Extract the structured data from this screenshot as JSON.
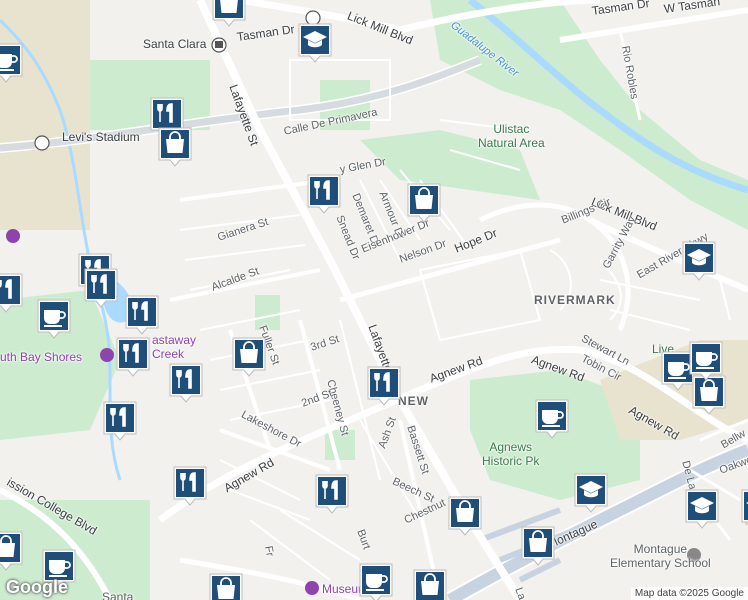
{
  "map": {
    "attribution": "Map data ©2025 Google",
    "google_logo": "Google",
    "street_labels": [
      {
        "id": "lick-mill-blvd-top",
        "text": "Lick Mill Blvd"
      },
      {
        "id": "tasman-dr",
        "text": "Tasman Dr"
      },
      {
        "id": "w-tasman",
        "text": "W Tasman"
      },
      {
        "id": "tasman-dr-right",
        "text": "Tasman Dr"
      },
      {
        "id": "rio-robles",
        "text": "Rio Robles"
      },
      {
        "id": "lafayette-st-north",
        "text": "Lafayette St"
      },
      {
        "id": "calle-de-primavera",
        "text": "Calle De Primavera"
      },
      {
        "id": "glen-dr",
        "text": "y Glen Dr"
      },
      {
        "id": "gianera-st",
        "text": "Gianera St"
      },
      {
        "id": "snead-dr",
        "text": "Snead Dr"
      },
      {
        "id": "demaret-dr",
        "text": "Demaret Dr"
      },
      {
        "id": "armour-dr",
        "text": "Armour Dr"
      },
      {
        "id": "eisenhower-dr",
        "text": "Eisenhower Dr"
      },
      {
        "id": "nelson-dr",
        "text": "Nelson Dr"
      },
      {
        "id": "hope-dr",
        "text": "Hope Dr"
      },
      {
        "id": "alcalde-st",
        "text": "Alcalde St"
      },
      {
        "id": "lick-mill-blvd-right",
        "text": "Lick Mill Blvd"
      },
      {
        "id": "billings-cir",
        "text": "Billings Cir"
      },
      {
        "id": "garrity-way",
        "text": "Garrity Way"
      },
      {
        "id": "east-river-pkwy",
        "text": "East River Pkwy"
      },
      {
        "id": "fuller-st",
        "text": "Fuller St"
      },
      {
        "id": "3rd-st",
        "text": "3rd St"
      },
      {
        "id": "lafayette-st-south",
        "text": "Lafayette St"
      },
      {
        "id": "cheeney-st",
        "text": "Cheeney St"
      },
      {
        "id": "2nd-st",
        "text": "2nd St"
      },
      {
        "id": "lakeshore-dr",
        "text": "Lakeshore Dr"
      },
      {
        "id": "agnew-rd-center",
        "text": "Agnew Rd"
      },
      {
        "id": "agnew-rd-right",
        "text": "Agnew Rd"
      },
      {
        "id": "agnew-rd-far-right",
        "text": "Agnew Rd"
      },
      {
        "id": "stewart-ln",
        "text": "Stewart Ln"
      },
      {
        "id": "tobin-cir",
        "text": "Tobin Cir"
      },
      {
        "id": "ash-st",
        "text": "Ash St"
      },
      {
        "id": "bassett-st",
        "text": "Bassett St"
      },
      {
        "id": "beech-st",
        "text": "Beech St"
      },
      {
        "id": "chestnut",
        "text": "Chestnut"
      },
      {
        "id": "agnew-rd-left",
        "text": "Agnew Rd"
      },
      {
        "id": "mission-college-blvd",
        "text": "ission College Blvd"
      },
      {
        "id": "montague",
        "text": "Montague"
      },
      {
        "id": "de-la-cruz",
        "text": "De La"
      },
      {
        "id": "bellwood",
        "text": "Bellw"
      },
      {
        "id": "oakwood",
        "text": "Oakwo"
      },
      {
        "id": "burton",
        "text": "Burt"
      },
      {
        "id": "fr",
        "text": "Fr"
      },
      {
        "id": "lafa-bottom",
        "text": "La"
      }
    ],
    "place_labels": [
      {
        "id": "santa-clara-station",
        "text": "Santa Clara"
      },
      {
        "id": "levis-stadium",
        "text": "Levi's Stadium"
      },
      {
        "id": "ulistac",
        "text": "Ulistac\nNatural Area"
      },
      {
        "id": "rivermark",
        "text": "RIVERMARK"
      },
      {
        "id": "agnew-partial",
        "text": "NEW"
      },
      {
        "id": "agnews-historic-pk",
        "text": "Agnews\nHistoric Pk"
      },
      {
        "id": "south-bay-shores",
        "text": "uth Bay Shores"
      },
      {
        "id": "castaway-creek",
        "text": "astaway\nCreek"
      },
      {
        "id": "guadalupe-river",
        "text": "Guadalupe River"
      },
      {
        "id": "montague-elementary",
        "text": "Montague\nElementary School"
      },
      {
        "id": "museum",
        "text": "Museum"
      },
      {
        "id": "live-partial",
        "text": "Live"
      },
      {
        "id": "santa-partial",
        "text": "Santa"
      }
    ],
    "markers": [
      {
        "id": "m1",
        "icon": "shopping-bag-icon"
      },
      {
        "id": "m2",
        "icon": "school-cap-icon"
      },
      {
        "id": "m3",
        "icon": "coffee-cup-icon"
      },
      {
        "id": "m4",
        "icon": "restaurant-icon"
      },
      {
        "id": "m5",
        "icon": "shopping-bag-icon"
      },
      {
        "id": "m6",
        "icon": "restaurant-icon"
      },
      {
        "id": "m7",
        "icon": "shopping-bag-icon"
      },
      {
        "id": "m8",
        "icon": "school-cap-icon"
      },
      {
        "id": "m9",
        "icon": "restaurant-icon"
      },
      {
        "id": "m10",
        "icon": "restaurant-icon"
      },
      {
        "id": "m11",
        "icon": "coffee-cup-icon"
      },
      {
        "id": "m12",
        "icon": "restaurant-icon"
      },
      {
        "id": "m13",
        "icon": "restaurant-icon"
      },
      {
        "id": "m14",
        "icon": "shopping-bag-icon"
      },
      {
        "id": "m15",
        "icon": "restaurant-icon"
      },
      {
        "id": "m16",
        "icon": "restaurant-icon"
      },
      {
        "id": "m17",
        "icon": "restaurant-icon"
      },
      {
        "id": "m18",
        "icon": "coffee-cup-icon"
      },
      {
        "id": "m19",
        "icon": "coffee-cup-icon"
      },
      {
        "id": "m20",
        "icon": "shopping-bag-icon"
      },
      {
        "id": "m21",
        "icon": "restaurant-icon"
      },
      {
        "id": "m22",
        "icon": "shopping-bag-icon"
      },
      {
        "id": "m23",
        "icon": "school-cap-icon"
      },
      {
        "id": "m24",
        "icon": "school-cap-icon"
      },
      {
        "id": "m25",
        "icon": "restaurant-icon"
      },
      {
        "id": "m26",
        "icon": "coffee-cup-icon"
      },
      {
        "id": "m27",
        "icon": "shopping-bag-icon"
      },
      {
        "id": "m28",
        "icon": "shopping-bag-icon"
      },
      {
        "id": "m29",
        "icon": "coffee-cup-icon"
      },
      {
        "id": "m30",
        "icon": "coffee-cup-icon"
      },
      {
        "id": "m31",
        "icon": "shopping-bag-icon"
      },
      {
        "id": "m32",
        "icon": "restaurant-icon"
      },
      {
        "id": "m33",
        "icon": "coffee-cup-icon"
      },
      {
        "id": "m34",
        "icon": "shopping-bag-icon"
      },
      {
        "id": "m35",
        "icon": "school-cap-icon"
      }
    ],
    "colors": {
      "marker": "#1f4e79",
      "park": "#c8e6c9",
      "water": "#aadaff",
      "highway": "#c7d3e0",
      "road": "#ffffff"
    }
  }
}
